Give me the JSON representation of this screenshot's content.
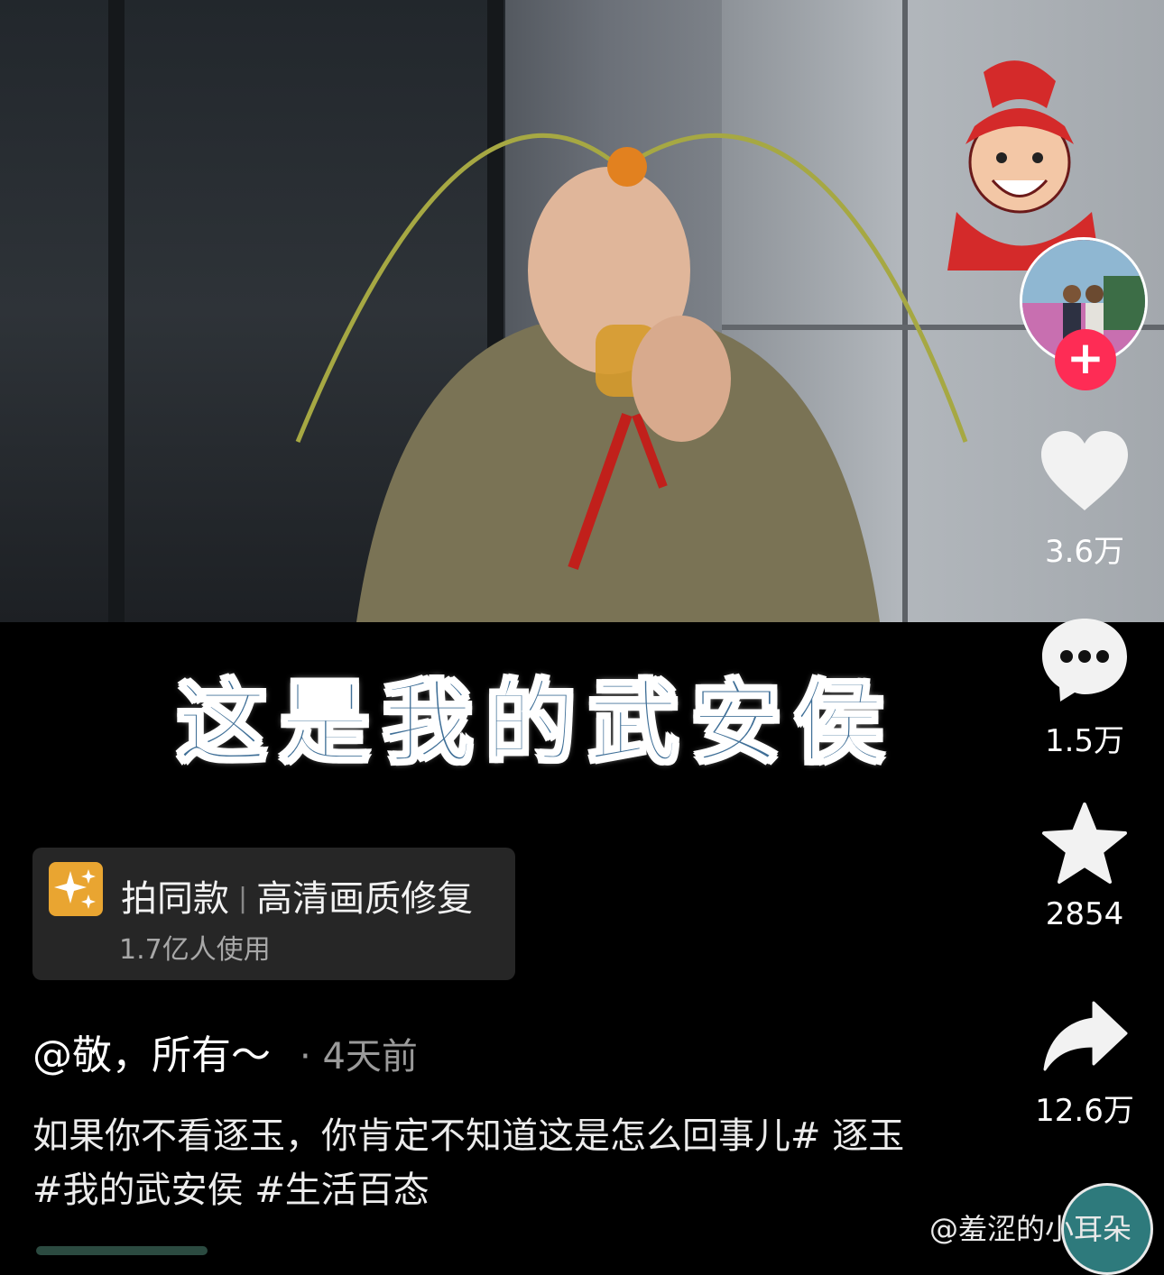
{
  "overlay_caption": "这是我的武安侯",
  "effect": {
    "title": "拍同款",
    "separator": "|",
    "name": "高清画质修复",
    "users": "1.7亿人使用",
    "icon": "sparkle-icon",
    "icon_color": "#e9a531"
  },
  "post": {
    "author": "@敬，所有～",
    "time_separator": "·",
    "time": "4天前",
    "description": "如果你不看逐玉，你肯定不知道这是怎么回事儿# 逐玉 #我的武安侯 #生活百态"
  },
  "rail": {
    "follow_label": "+",
    "follow_color": "#fe2c55",
    "like_count": "3.6万",
    "comment_count": "1.5万",
    "favorite_count": "2854",
    "share_count": "12.6万"
  },
  "watermark": "@羞涩的小耳朵"
}
